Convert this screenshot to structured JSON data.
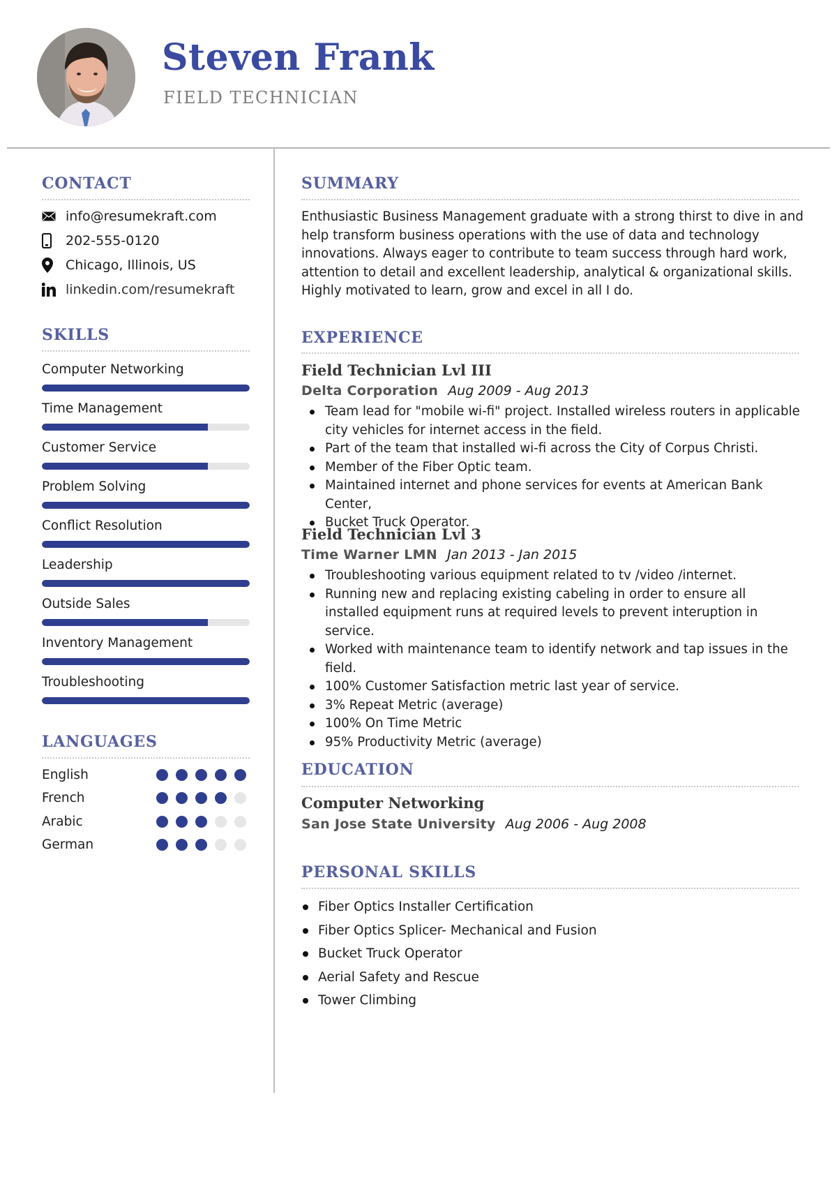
{
  "header": {
    "name": "Steven Frank",
    "role": "FIELD TECHNICIAN",
    "photo_alt": "profile-photo"
  },
  "colors": {
    "accent": "#2f3e8e",
    "heading": "#56609f",
    "name": "#3a4aa0",
    "muted": "#7d7d7d",
    "track": "#e5e5e5"
  },
  "contact": {
    "heading": "CONTACT",
    "items": [
      {
        "icon": "envelope-icon",
        "text": "info@resumekraft.com"
      },
      {
        "icon": "phone-icon",
        "text": "202-555-0120"
      },
      {
        "icon": "location-pin-icon",
        "text": "Chicago, Illinois, US"
      },
      {
        "icon": "linkedin-icon",
        "text": "linkedin.com/resumekraft"
      }
    ]
  },
  "skills": {
    "heading": "SKILLS",
    "items": [
      {
        "label": "Computer Networking",
        "level": 1.0
      },
      {
        "label": "Time Management",
        "level": 0.8
      },
      {
        "label": "Customer Service",
        "level": 0.8
      },
      {
        "label": "Problem Solving",
        "level": 1.0
      },
      {
        "label": "Conflict Resolution",
        "level": 1.0
      },
      {
        "label": "Leadership",
        "level": 1.0
      },
      {
        "label": "Outside Sales",
        "level": 0.8
      },
      {
        "label": "Inventory Management",
        "level": 1.0
      },
      {
        "label": "Troubleshooting",
        "level": 1.0
      }
    ]
  },
  "languages": {
    "heading": "LANGUAGES",
    "max": 5,
    "items": [
      {
        "label": "English",
        "rating": 5
      },
      {
        "label": "French",
        "rating": 4
      },
      {
        "label": "Arabic",
        "rating": 3
      },
      {
        "label": "German",
        "rating": 3
      }
    ]
  },
  "summary": {
    "heading": "SUMMARY",
    "text": "Enthusiastic Business Management graduate with a strong thirst to dive in and help transform business operations with the use of data and technology innovations. Always eager to contribute to team success through hard work, attention to detail and excellent leadership, analytical & organizational skills. Highly motivated to learn, grow and excel in all I do."
  },
  "experience": {
    "heading": "EXPERIENCE",
    "jobs": [
      {
        "title": "Field Technician Lvl III",
        "company": "Delta Corporation",
        "dates": "Aug 2009 - Aug 2013",
        "bullets": [
          "Team lead for \"mobile wi-fi\" project. Installed wireless routers in applicable city vehicles for internet access in the field.",
          "Part of the team that installed wi-fi across the City of Corpus Christi.",
          "Member of the Fiber Optic team.",
          "Maintained internet and phone services for events at American Bank Center,",
          "Bucket Truck Operator."
        ]
      },
      {
        "title": "Field Technician Lvl 3",
        "company": "Time Warner LMN",
        "dates": "Jan 2013 - Jan 2015",
        "bullets": [
          "Troubleshooting various equipment related to tv /video /internet.",
          "Running new and replacing existing cabeling in order to ensure all installed equipment runs at required levels to prevent interuption in service.",
          "Worked with maintenance team to identify network and tap issues in the field.",
          "100% Customer Satisfaction metric last year of service.",
          "3% Repeat Metric (average)",
          "100% On Time Metric",
          "95% Productivity Metric (average)"
        ]
      }
    ]
  },
  "education": {
    "heading": "EDUCATION",
    "degree": "Computer Networking",
    "school": "San Jose State University",
    "dates": "Aug 2006 - Aug 2008"
  },
  "personal_skills": {
    "heading": "PERSONAL SKILLS",
    "items": [
      "Fiber Optics Installer Certification",
      "Fiber Optics Splicer- Mechanical and Fusion",
      "Bucket Truck Operator",
      "Aerial Safety and Rescue",
      "Tower Climbing"
    ]
  }
}
